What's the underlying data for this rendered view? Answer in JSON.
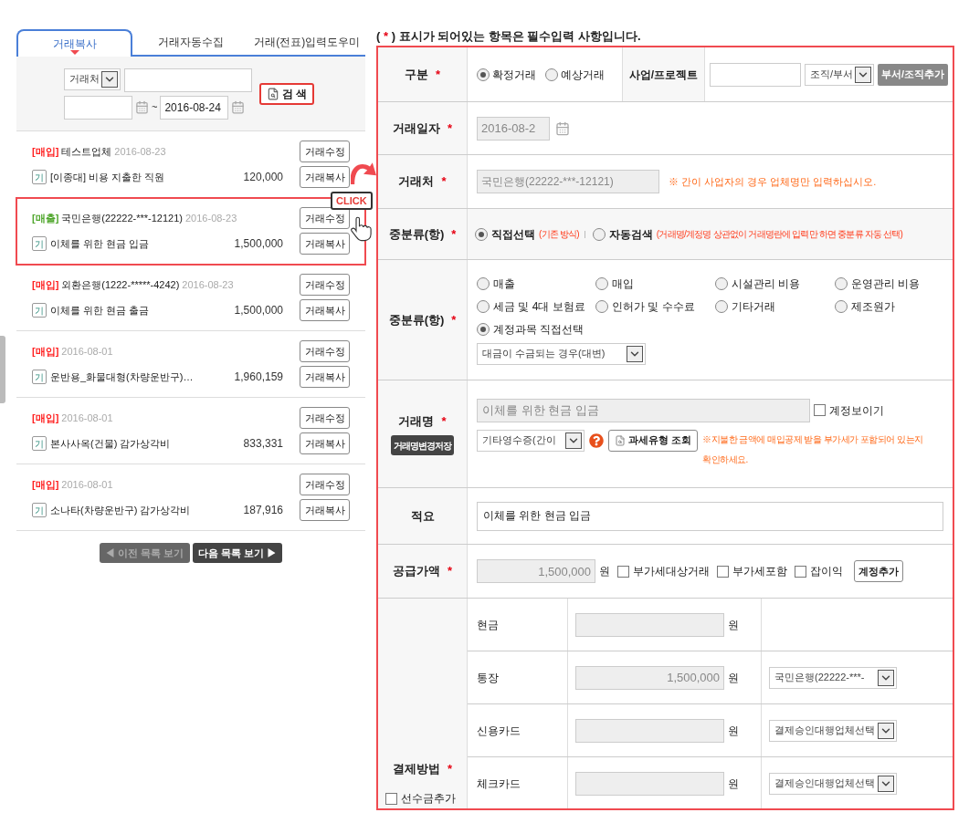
{
  "left_tabs": [
    {
      "label": "거래복사",
      "selected": true
    },
    {
      "label": "거래자동수집",
      "selected": false
    },
    {
      "label": "거래(전표)입력도우미",
      "selected": false
    }
  ],
  "search": {
    "field_select": "거래처",
    "date_to": "2016-08-24",
    "range_separator": "~",
    "button": "검 색"
  },
  "transactions": [
    {
      "type_label": "[매입]",
      "color": "#ff1e1e",
      "partner": "테스트업체",
      "date": "2016-08-23",
      "badge": "기",
      "description": "[이종대] 비용 지출한 직원",
      "amount": "120,000",
      "edit_button": "거래수정",
      "copy_button": "거래복사",
      "highlighted": false
    },
    {
      "type_label": "[매출]",
      "color": "#4fa62c",
      "partner": "국민은행(22222-***-12121)",
      "date": "2016-08-23",
      "badge": "기",
      "description": "이체를 위한 현금 입금",
      "amount": "1,500,000",
      "edit_button": "거래수정",
      "copy_button": "거래복사",
      "highlighted": true
    },
    {
      "type_label": "[매입]",
      "color": "#ff1e1e",
      "partner": "외환은행(1222-*****-4242)",
      "date": "2016-08-23",
      "badge": "기",
      "description": "이체를 위한 현금 출금",
      "amount": "1,500,000",
      "edit_button": "거래수정",
      "copy_button": "거래복사",
      "highlighted": false
    },
    {
      "type_label": "[매입]",
      "color": "#ff1e1e",
      "date": "2016-08-01",
      "badge": "기",
      "description": "운반용_화물대형(차량운반구)…",
      "amount": "1,960,159",
      "edit_button": "거래수정",
      "copy_button": "거래복사",
      "highlighted": false
    },
    {
      "type_label": "[매입]",
      "color": "#ff1e1e",
      "date": "2016-08-01",
      "badge": "기",
      "description": "본사사옥(건물) 감가상각비",
      "amount": "833,331",
      "edit_button": "거래수정",
      "copy_button": "거래복사",
      "highlighted": false
    },
    {
      "type_label": "[매입]",
      "color": "#ff1e1e",
      "date": "2016-08-01",
      "badge": "기",
      "description": "소나타(차량운반구) 감가상각비",
      "amount": "187,916",
      "edit_button": "거래수정",
      "copy_button": "거래복사",
      "highlighted": false
    }
  ],
  "callout": {
    "label": "CLICK"
  },
  "pagination": {
    "prev": {
      "label": "◀ 이전 목록 보기",
      "disabled": true
    },
    "next": {
      "label": "다음 목록 보기 ▶",
      "disabled": false
    }
  },
  "required_note": {
    "open": "(",
    "mark": "*",
    "rest": ") 표시가 되어있는 항목은 필수입력 사항입니다."
  },
  "form": {
    "type_row": {
      "label": "구분",
      "required": true,
      "options": [
        {
          "label": "확정거래",
          "selected": true
        },
        {
          "label": "예상거래",
          "selected": false
        }
      ],
      "project_label": "사업/프로젝트",
      "org_select": "조직/부서",
      "add_org_button": "부서/조직추가"
    },
    "date_row": {
      "label": "거래일자",
      "required": true,
      "value": "2016-08-2"
    },
    "partner_row": {
      "label": "거래처",
      "required": true,
      "value": "국민은행(22222-***-12121)",
      "hint": "※ 간이 사업자의 경우 업체명만 입력하십시오."
    },
    "mode_row": {
      "label": "중분류(항)",
      "required": true,
      "options": [
        {
          "label": "직접선택",
          "note": "(기존 방식)",
          "selected": true
        },
        {
          "label": "자동검색",
          "note": "(거래명/계정명 상관없이 거래명란에 입력만 하면 중분류 자동 선택)",
          "selected": false
        }
      ]
    },
    "category_row": {
      "label": "중분류(항)",
      "required": true,
      "options": [
        {
          "label": "매출",
          "selected": false
        },
        {
          "label": "매입",
          "selected": false
        },
        {
          "label": "시설관리 비용",
          "selected": false
        },
        {
          "label": "운영관리 비용",
          "selected": false
        },
        {
          "label": "세금 및 4대 보험료",
          "selected": false
        },
        {
          "label": "인허가 및 수수료",
          "selected": false
        },
        {
          "label": "기타거래",
          "selected": false
        },
        {
          "label": "제조원가",
          "selected": false
        },
        {
          "label": "계정과목 직접선택",
          "selected": true
        }
      ],
      "account_select": "대금이 수금되는 경우(대변)"
    },
    "name_row": {
      "label": "거래명",
      "required": true,
      "save_button": "거래명변경저장",
      "value": "이체를 위한 현금 입금",
      "show_account": {
        "label": "계정보이기",
        "checked": false
      },
      "receipt_select": "기타영수증(간이",
      "tax_button": "과세유형 조회",
      "warning": "※지불한 금액에 매입공제 받을 부가세가 포함되어 있는지 확인하세요."
    },
    "memo_row": {
      "label": "적요",
      "required": false,
      "value": "이체를 위한 현금 입금"
    },
    "amount_row": {
      "label": "공급가액",
      "required": true,
      "value": "1,500,000",
      "unit": "원",
      "checks": [
        {
          "label": "부가세대상거래",
          "checked": false
        },
        {
          "label": "부가세포함",
          "checked": false
        },
        {
          "label": "잡이익",
          "checked": false
        }
      ],
      "add_button": "계정추가"
    },
    "payment": {
      "label": "결제방법",
      "required": true,
      "advance": {
        "label": "선수금추가",
        "checked": false
      },
      "methods": [
        {
          "label": "현금",
          "unit": "원"
        },
        {
          "label": "통장",
          "value": "1,500,000",
          "unit": "원",
          "select": "국민은행(22222-***-"
        },
        {
          "label": "신용카드",
          "unit": "원",
          "select": "결제승인대행업체선택"
        },
        {
          "label": "체크카드",
          "unit": "원",
          "select": "결제승인대행업체선택"
        }
      ]
    }
  }
}
